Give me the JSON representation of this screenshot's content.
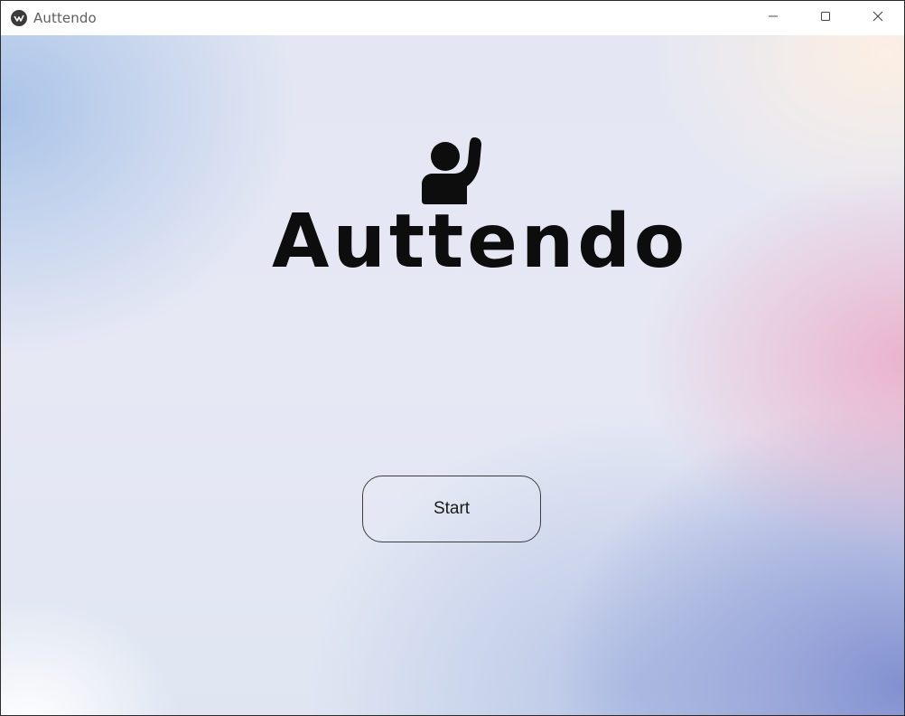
{
  "window": {
    "title": "Auttendo",
    "app_icon": "kivy-logo-icon",
    "controls": {
      "minimize": "minimize-icon",
      "maximize": "maximize-icon",
      "close": "close-icon"
    }
  },
  "main": {
    "logo_icon": "raised-hand-person-icon",
    "logo_text": "Auttendo",
    "start_label": "Start"
  }
}
